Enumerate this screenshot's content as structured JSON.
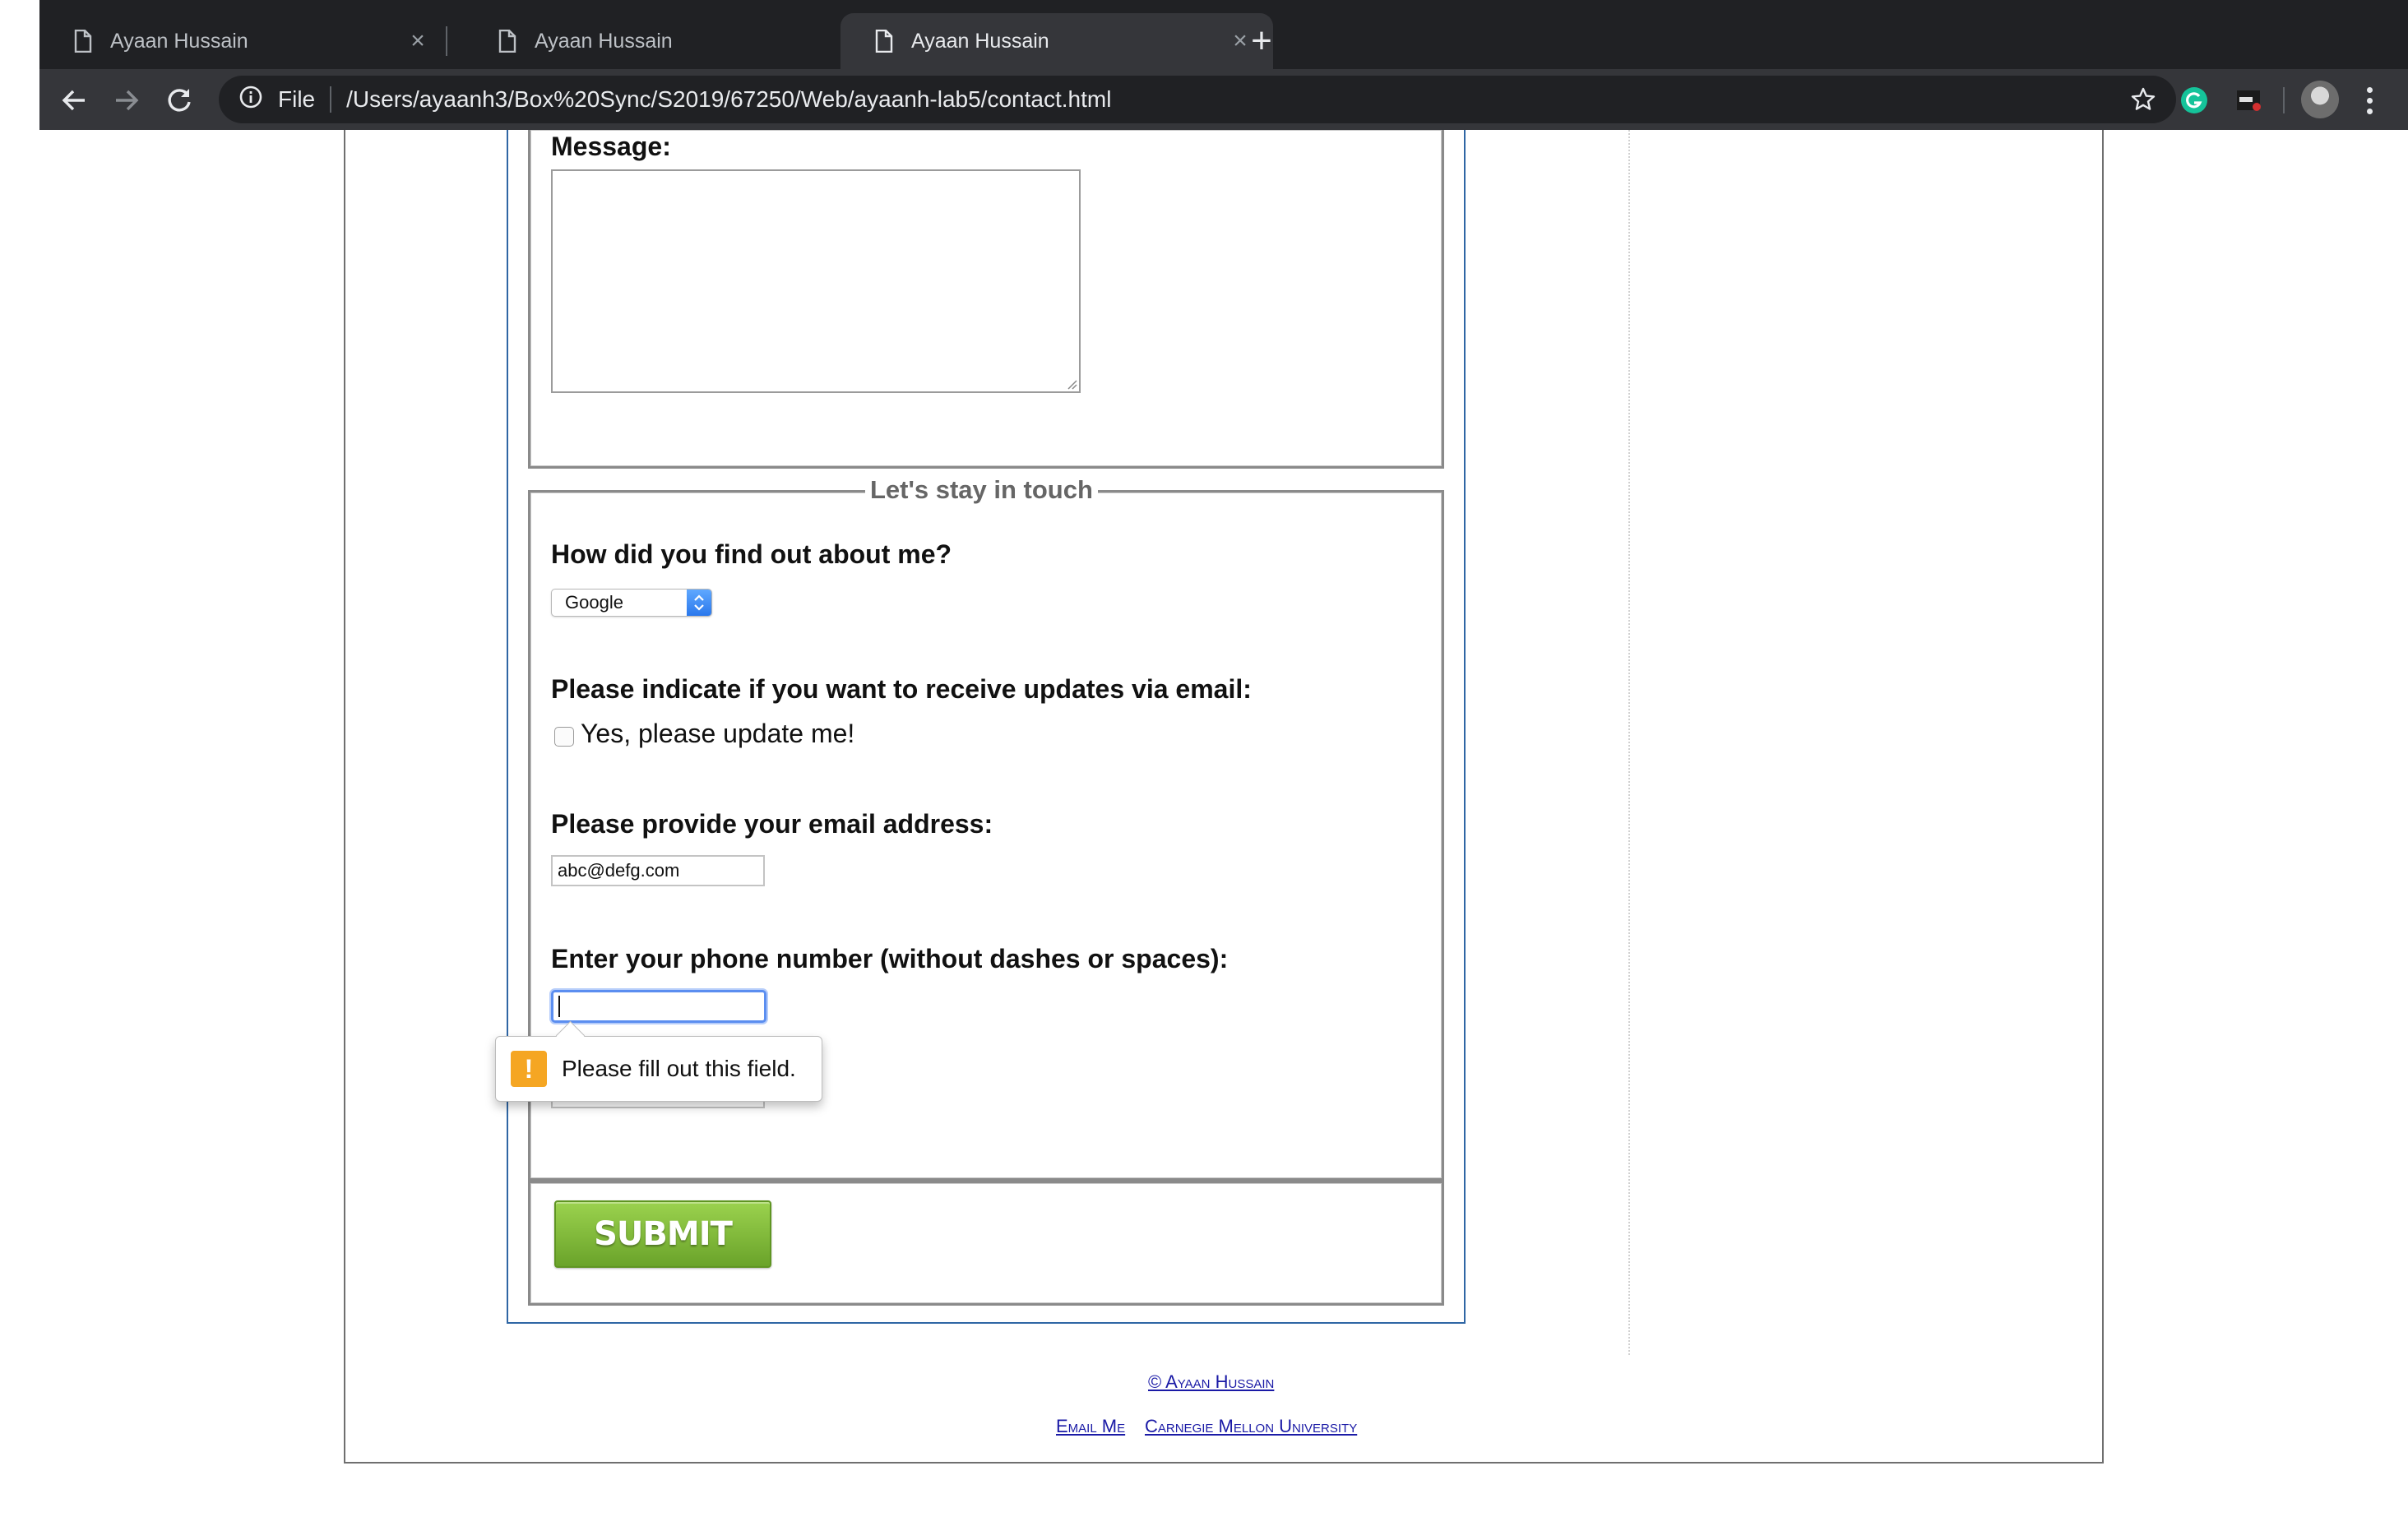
{
  "browser": {
    "tabs": [
      {
        "title": "Ayaan Hussain",
        "active": false
      },
      {
        "title": "Ayaan Hussain",
        "active": false
      },
      {
        "title": "Ayaan Hussain",
        "active": true
      }
    ],
    "new_tab_glyph": "+",
    "close_glyph": "×",
    "address": {
      "scheme_label": "File",
      "url": "/Users/ayaanh3/Box%20Sync/S2019/67250/Web/ayaanh-lab5/contact.html"
    },
    "icons": [
      "back-icon",
      "forward-icon",
      "reload-icon",
      "info-icon",
      "star-icon",
      "grammarly-icon",
      "seo-icon",
      "profile-avatar",
      "kebab-menu-icon"
    ]
  },
  "form": {
    "message_label": "Message:",
    "message_value": "",
    "touch_legend": "Let's stay in touch",
    "source_label": "How did you find out about me?",
    "source_selected": "Google",
    "updates_label": "Please indicate if you want to receive updates via email:",
    "updates_checkbox_label": "Yes, please update me!",
    "updates_checked": false,
    "email_label": "Please provide your email address:",
    "email_value": "abc@defg.com",
    "phone_label": "Enter your phone number (without dashes or spaces):",
    "phone_value": "",
    "validation_message": "Please fill out this field.",
    "validation_icon_glyph": "!",
    "submit_label": "SUBMIT"
  },
  "footer": {
    "copyright": "© Ayaan Hussain",
    "email_link": "Email Me",
    "university_link": "Carnegie Mellon University"
  },
  "colors": {
    "chrome_bg": "#202124",
    "toolbar_bg": "#35363a",
    "form_border": "#2f66a4",
    "submit_green": "#7cb83a",
    "focus_blue": "#5b8ef0",
    "warning_orange": "#f5a623",
    "link_blue": "#1a1aa6"
  }
}
